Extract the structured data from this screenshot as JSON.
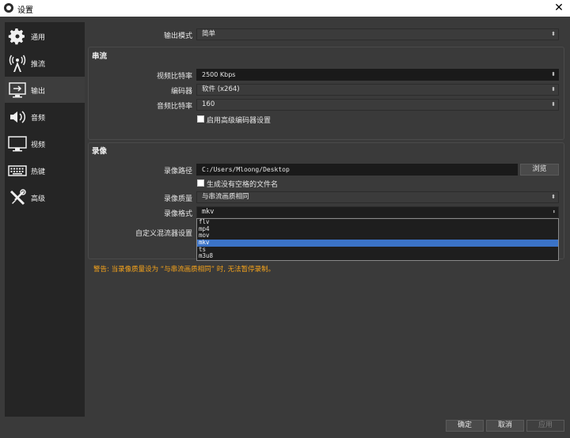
{
  "window": {
    "title": "设置",
    "close": "✕"
  },
  "sidebar": {
    "items": [
      {
        "label": "通用",
        "icon": "gear-icon"
      },
      {
        "label": "推流",
        "icon": "antenna-icon"
      },
      {
        "label": "输出",
        "icon": "output-icon",
        "active": true
      },
      {
        "label": "音频",
        "icon": "speaker-icon"
      },
      {
        "label": "视频",
        "icon": "monitor-icon"
      },
      {
        "label": "热键",
        "icon": "keyboard-icon"
      },
      {
        "label": "高级",
        "icon": "tools-icon"
      }
    ]
  },
  "output_mode": {
    "label": "输出模式",
    "value": "简单"
  },
  "streaming": {
    "title": "串流",
    "video_bitrate": {
      "label": "视频比特率",
      "value": "2500 Kbps"
    },
    "encoder": {
      "label": "编码器",
      "value": "软件 (x264)"
    },
    "audio_bitrate": {
      "label": "音频比特率",
      "value": "160"
    },
    "advanced_encoder": {
      "label": "启用高级编码器设置"
    }
  },
  "recording": {
    "title": "录像",
    "path": {
      "label": "录像路径",
      "value": "C:/Users/Mloong/Desktop",
      "browse": "浏览"
    },
    "no_space_filename": {
      "label": "生成没有空格的文件名"
    },
    "quality": {
      "label": "录像质量",
      "value": "与串流画质相同"
    },
    "format": {
      "label": "录像格式",
      "value": "mkv",
      "options": [
        "flv",
        "mp4",
        "mov",
        "mkv",
        "ts",
        "m3u8"
      ],
      "selected": "mkv"
    },
    "custom_muxer": {
      "label": "自定义混流器设置"
    }
  },
  "warning": "警告: 当录像质量设为 “与串流画质相同” 时, 无法暂停录制。",
  "buttons": {
    "ok": "确定",
    "cancel": "取消",
    "apply": "应用"
  },
  "colors": {
    "accent": "#3b73c7",
    "warning": "#f5a31b"
  }
}
